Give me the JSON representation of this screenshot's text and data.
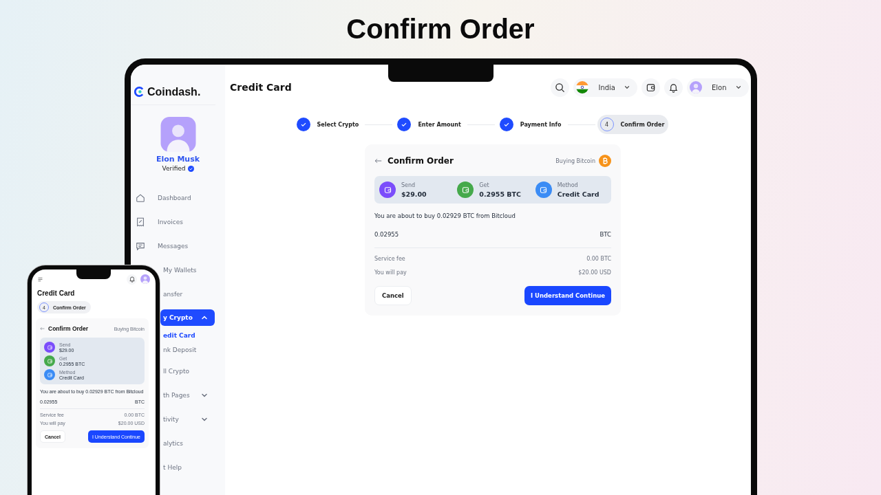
{
  "headline": "Confirm Order",
  "laptop": {
    "sidebar": {
      "brand": "Coindash.",
      "profile": {
        "name": "Elon Musk",
        "status": "Verified",
        "verified": true
      },
      "items": [
        {
          "label": "Dashboard",
          "selected": false
        },
        {
          "label": "Invoices",
          "selected": false
        },
        {
          "label": "Messages",
          "selected": false
        },
        {
          "label": "My Wallets",
          "selected": false
        },
        {
          "label": "ansfer",
          "selected": false
        },
        {
          "label": "y Crypto",
          "selected": true,
          "expanded": true,
          "children": [
            {
              "label": "edit Card",
              "selected": true
            },
            {
              "label": "nk Deposit",
              "selected": false
            }
          ]
        },
        {
          "label": "ll Crypto",
          "selected": false
        },
        {
          "label": "th Pages",
          "selected": false,
          "expanded": false
        },
        {
          "label": "tivity",
          "selected": false,
          "expanded": false
        },
        {
          "label": "alytics",
          "selected": false
        },
        {
          "label": "t Help",
          "selected": false
        }
      ]
    },
    "header": {
      "title": "Credit Card",
      "country": "India",
      "user": "Elon"
    },
    "steps": [
      {
        "label": "Select Crypto",
        "done": true,
        "selected": false
      },
      {
        "label": "Enter Amount",
        "done": true,
        "selected": false
      },
      {
        "label": "Payment Info",
        "done": true,
        "selected": false
      },
      {
        "label": "Confirm Order",
        "number": "4",
        "done": false,
        "selected": true
      }
    ],
    "card": {
      "title": "Confirm Order",
      "subtitle": "Buying Bitcoin",
      "coin": true,
      "summary": [
        {
          "label": "Send",
          "value": "$29.00",
          "color": "#7b4dfb"
        },
        {
          "label": "Get",
          "value": "0.2955 BTC",
          "color": "#45a94b"
        },
        {
          "label": "Method",
          "value": "Credit Card",
          "color": "#3b8cf5"
        }
      ],
      "message": "You are about to buy 0.02929 BTC from Bitcloud",
      "amount": "0.02955",
      "unit": "BTC",
      "fees": [
        {
          "label": "Service fee",
          "value": "0.00 BTC"
        },
        {
          "label": "You will pay",
          "value": "$20.00 USD"
        }
      ],
      "cancel": "Cancel",
      "confirm": "I Understand Continue"
    }
  },
  "phone": {
    "title": "Credit Card",
    "step": {
      "number": "4",
      "label": "Confirm Order"
    },
    "card": {
      "title": "Confirm Order",
      "subtitle": "Buying Bitcoin",
      "coin": false,
      "summary": [
        {
          "label": "Send",
          "value": "$29.00",
          "color": "#7b4dfb"
        },
        {
          "label": "Get",
          "value": "0.2955 BTC",
          "color": "#45a94b"
        },
        {
          "label": "Method",
          "value": "Credit Card",
          "color": "#3b8cf5"
        }
      ],
      "message": "You are about to buy 0.02929 BTC from Bitcloud",
      "amount": "0.02955",
      "unit": "BTC",
      "fees": [
        {
          "label": "Service fee",
          "value": "0.00 BTC"
        },
        {
          "label": "You will pay",
          "value": "$20.00 USD"
        }
      ],
      "cancel": "Cancel",
      "confirm": "I Understand Continue"
    }
  }
}
